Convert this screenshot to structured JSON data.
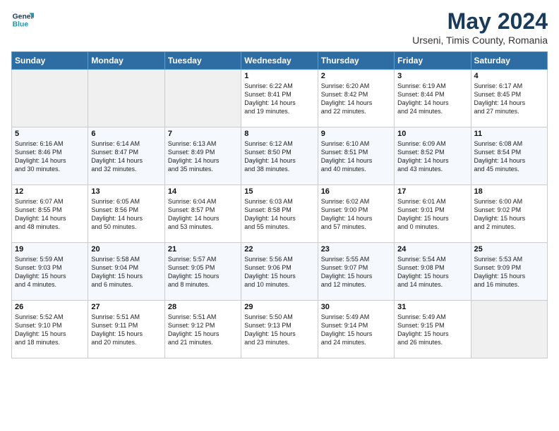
{
  "logo": {
    "line1": "General",
    "line2": "Blue"
  },
  "title": "May 2024",
  "subtitle": "Urseni, Timis County, Romania",
  "days_header": [
    "Sunday",
    "Monday",
    "Tuesday",
    "Wednesday",
    "Thursday",
    "Friday",
    "Saturday"
  ],
  "weeks": [
    [
      {
        "num": "",
        "info": ""
      },
      {
        "num": "",
        "info": ""
      },
      {
        "num": "",
        "info": ""
      },
      {
        "num": "1",
        "info": "Sunrise: 6:22 AM\nSunset: 8:41 PM\nDaylight: 14 hours\nand 19 minutes."
      },
      {
        "num": "2",
        "info": "Sunrise: 6:20 AM\nSunset: 8:42 PM\nDaylight: 14 hours\nand 22 minutes."
      },
      {
        "num": "3",
        "info": "Sunrise: 6:19 AM\nSunset: 8:44 PM\nDaylight: 14 hours\nand 24 minutes."
      },
      {
        "num": "4",
        "info": "Sunrise: 6:17 AM\nSunset: 8:45 PM\nDaylight: 14 hours\nand 27 minutes."
      }
    ],
    [
      {
        "num": "5",
        "info": "Sunrise: 6:16 AM\nSunset: 8:46 PM\nDaylight: 14 hours\nand 30 minutes."
      },
      {
        "num": "6",
        "info": "Sunrise: 6:14 AM\nSunset: 8:47 PM\nDaylight: 14 hours\nand 32 minutes."
      },
      {
        "num": "7",
        "info": "Sunrise: 6:13 AM\nSunset: 8:49 PM\nDaylight: 14 hours\nand 35 minutes."
      },
      {
        "num": "8",
        "info": "Sunrise: 6:12 AM\nSunset: 8:50 PM\nDaylight: 14 hours\nand 38 minutes."
      },
      {
        "num": "9",
        "info": "Sunrise: 6:10 AM\nSunset: 8:51 PM\nDaylight: 14 hours\nand 40 minutes."
      },
      {
        "num": "10",
        "info": "Sunrise: 6:09 AM\nSunset: 8:52 PM\nDaylight: 14 hours\nand 43 minutes."
      },
      {
        "num": "11",
        "info": "Sunrise: 6:08 AM\nSunset: 8:54 PM\nDaylight: 14 hours\nand 45 minutes."
      }
    ],
    [
      {
        "num": "12",
        "info": "Sunrise: 6:07 AM\nSunset: 8:55 PM\nDaylight: 14 hours\nand 48 minutes."
      },
      {
        "num": "13",
        "info": "Sunrise: 6:05 AM\nSunset: 8:56 PM\nDaylight: 14 hours\nand 50 minutes."
      },
      {
        "num": "14",
        "info": "Sunrise: 6:04 AM\nSunset: 8:57 PM\nDaylight: 14 hours\nand 53 minutes."
      },
      {
        "num": "15",
        "info": "Sunrise: 6:03 AM\nSunset: 8:58 PM\nDaylight: 14 hours\nand 55 minutes."
      },
      {
        "num": "16",
        "info": "Sunrise: 6:02 AM\nSunset: 9:00 PM\nDaylight: 14 hours\nand 57 minutes."
      },
      {
        "num": "17",
        "info": "Sunrise: 6:01 AM\nSunset: 9:01 PM\nDaylight: 15 hours\nand 0 minutes."
      },
      {
        "num": "18",
        "info": "Sunrise: 6:00 AM\nSunset: 9:02 PM\nDaylight: 15 hours\nand 2 minutes."
      }
    ],
    [
      {
        "num": "19",
        "info": "Sunrise: 5:59 AM\nSunset: 9:03 PM\nDaylight: 15 hours\nand 4 minutes."
      },
      {
        "num": "20",
        "info": "Sunrise: 5:58 AM\nSunset: 9:04 PM\nDaylight: 15 hours\nand 6 minutes."
      },
      {
        "num": "21",
        "info": "Sunrise: 5:57 AM\nSunset: 9:05 PM\nDaylight: 15 hours\nand 8 minutes."
      },
      {
        "num": "22",
        "info": "Sunrise: 5:56 AM\nSunset: 9:06 PM\nDaylight: 15 hours\nand 10 minutes."
      },
      {
        "num": "23",
        "info": "Sunrise: 5:55 AM\nSunset: 9:07 PM\nDaylight: 15 hours\nand 12 minutes."
      },
      {
        "num": "24",
        "info": "Sunrise: 5:54 AM\nSunset: 9:08 PM\nDaylight: 15 hours\nand 14 minutes."
      },
      {
        "num": "25",
        "info": "Sunrise: 5:53 AM\nSunset: 9:09 PM\nDaylight: 15 hours\nand 16 minutes."
      }
    ],
    [
      {
        "num": "26",
        "info": "Sunrise: 5:52 AM\nSunset: 9:10 PM\nDaylight: 15 hours\nand 18 minutes."
      },
      {
        "num": "27",
        "info": "Sunrise: 5:51 AM\nSunset: 9:11 PM\nDaylight: 15 hours\nand 20 minutes."
      },
      {
        "num": "28",
        "info": "Sunrise: 5:51 AM\nSunset: 9:12 PM\nDaylight: 15 hours\nand 21 minutes."
      },
      {
        "num": "29",
        "info": "Sunrise: 5:50 AM\nSunset: 9:13 PM\nDaylight: 15 hours\nand 23 minutes."
      },
      {
        "num": "30",
        "info": "Sunrise: 5:49 AM\nSunset: 9:14 PM\nDaylight: 15 hours\nand 24 minutes."
      },
      {
        "num": "31",
        "info": "Sunrise: 5:49 AM\nSunset: 9:15 PM\nDaylight: 15 hours\nand 26 minutes."
      },
      {
        "num": "",
        "info": ""
      }
    ]
  ]
}
